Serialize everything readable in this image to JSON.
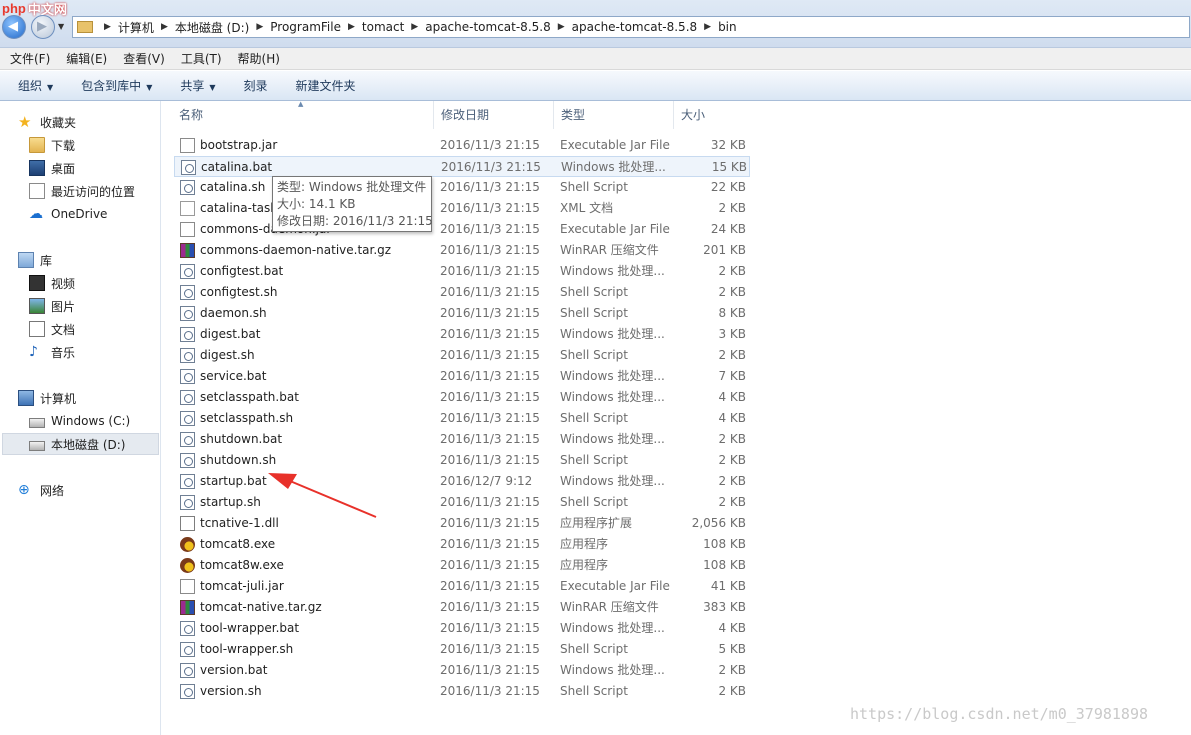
{
  "watermark_logo": {
    "text_left": "php",
    "text_right": "中文网"
  },
  "address_bar": {
    "crumbs": [
      "计算机",
      "本地磁盘 (D:)",
      "ProgramFile",
      "tomact",
      "apache-tomcat-8.5.8",
      "apache-tomcat-8.5.8",
      "bin"
    ]
  },
  "menu": [
    "文件(F)",
    "编辑(E)",
    "查看(V)",
    "工具(T)",
    "帮助(H)"
  ],
  "toolbar": {
    "organize": "组织",
    "include_in_library": "包含到库中",
    "share": "共享",
    "burn": "刻录",
    "new_folder": "新建文件夹"
  },
  "nav": {
    "favorites": "收藏夹",
    "downloads": "下载",
    "desktop": "桌面",
    "recent": "最近访问的位置",
    "onedrive": "OneDrive",
    "libraries": "库",
    "videos": "视频",
    "pictures": "图片",
    "documents": "文档",
    "music": "音乐",
    "computer": "计算机",
    "drive_c": "Windows (C:)",
    "drive_d": "本地磁盘 (D:)",
    "network": "网络"
  },
  "columns": {
    "name": "名称",
    "date": "修改日期",
    "type": "类型",
    "size": "大小"
  },
  "files": [
    {
      "name": "bootstrap.jar",
      "date": "2016/11/3 21:15",
      "type": "Executable Jar File",
      "size": "32 KB",
      "icon": "jar"
    },
    {
      "name": "catalina.bat",
      "date": "2016/11/3 21:15",
      "type": "Windows 批处理...",
      "size": "15 KB",
      "icon": "bat"
    },
    {
      "name": "catalina.sh",
      "date": "2016/11/3 21:15",
      "type": "Shell Script",
      "size": "22 KB",
      "icon": "bat"
    },
    {
      "name": "catalina-tasks.xml",
      "date": "2016/11/3 21:15",
      "type": "XML 文档",
      "size": "2 KB",
      "icon": "xml"
    },
    {
      "name": "commons-daemon.jar",
      "date": "2016/11/3 21:15",
      "type": "Executable Jar File",
      "size": "24 KB",
      "icon": "jar"
    },
    {
      "name": "commons-daemon-native.tar.gz",
      "date": "2016/11/3 21:15",
      "type": "WinRAR 压缩文件",
      "size": "201 KB",
      "icon": "rar"
    },
    {
      "name": "configtest.bat",
      "date": "2016/11/3 21:15",
      "type": "Windows 批处理...",
      "size": "2 KB",
      "icon": "bat"
    },
    {
      "name": "configtest.sh",
      "date": "2016/11/3 21:15",
      "type": "Shell Script",
      "size": "2 KB",
      "icon": "bat"
    },
    {
      "name": "daemon.sh",
      "date": "2016/11/3 21:15",
      "type": "Shell Script",
      "size": "8 KB",
      "icon": "bat"
    },
    {
      "name": "digest.bat",
      "date": "2016/11/3 21:15",
      "type": "Windows 批处理...",
      "size": "3 KB",
      "icon": "bat"
    },
    {
      "name": "digest.sh",
      "date": "2016/11/3 21:15",
      "type": "Shell Script",
      "size": "2 KB",
      "icon": "bat"
    },
    {
      "name": "service.bat",
      "date": "2016/11/3 21:15",
      "type": "Windows 批处理...",
      "size": "7 KB",
      "icon": "bat"
    },
    {
      "name": "setclasspath.bat",
      "date": "2016/11/3 21:15",
      "type": "Windows 批处理...",
      "size": "4 KB",
      "icon": "bat"
    },
    {
      "name": "setclasspath.sh",
      "date": "2016/11/3 21:15",
      "type": "Shell Script",
      "size": "4 KB",
      "icon": "bat"
    },
    {
      "name": "shutdown.bat",
      "date": "2016/11/3 21:15",
      "type": "Windows 批处理...",
      "size": "2 KB",
      "icon": "bat"
    },
    {
      "name": "shutdown.sh",
      "date": "2016/11/3 21:15",
      "type": "Shell Script",
      "size": "2 KB",
      "icon": "bat"
    },
    {
      "name": "startup.bat",
      "date": "2016/12/7 9:12",
      "type": "Windows 批处理...",
      "size": "2 KB",
      "icon": "bat"
    },
    {
      "name": "startup.sh",
      "date": "2016/11/3 21:15",
      "type": "Shell Script",
      "size": "2 KB",
      "icon": "bat"
    },
    {
      "name": "tcnative-1.dll",
      "date": "2016/11/3 21:15",
      "type": "应用程序扩展",
      "size": "2,056 KB",
      "icon": "dll"
    },
    {
      "name": "tomcat8.exe",
      "date": "2016/11/3 21:15",
      "type": "应用程序",
      "size": "108 KB",
      "icon": "exe"
    },
    {
      "name": "tomcat8w.exe",
      "date": "2016/11/3 21:15",
      "type": "应用程序",
      "size": "108 KB",
      "icon": "exe"
    },
    {
      "name": "tomcat-juli.jar",
      "date": "2016/11/3 21:15",
      "type": "Executable Jar File",
      "size": "41 KB",
      "icon": "jar"
    },
    {
      "name": "tomcat-native.tar.gz",
      "date": "2016/11/3 21:15",
      "type": "WinRAR 压缩文件",
      "size": "383 KB",
      "icon": "rar"
    },
    {
      "name": "tool-wrapper.bat",
      "date": "2016/11/3 21:15",
      "type": "Windows 批处理...",
      "size": "4 KB",
      "icon": "bat"
    },
    {
      "name": "tool-wrapper.sh",
      "date": "2016/11/3 21:15",
      "type": "Shell Script",
      "size": "5 KB",
      "icon": "bat"
    },
    {
      "name": "version.bat",
      "date": "2016/11/3 21:15",
      "type": "Windows 批处理...",
      "size": "2 KB",
      "icon": "bat"
    },
    {
      "name": "version.sh",
      "date": "2016/11/3 21:15",
      "type": "Shell Script",
      "size": "2 KB",
      "icon": "bat"
    }
  ],
  "hovered_file_index": 1,
  "tooltip": {
    "type": "类型: Windows 批处理文件",
    "size": "大小: 14.1 KB",
    "modified": "修改日期: 2016/11/3 21:15"
  },
  "annotation": {
    "arrow_color": "#e8312a",
    "points_to": "startup.bat"
  },
  "watermark_url": "https://blog.csdn.net/m0_37981898"
}
